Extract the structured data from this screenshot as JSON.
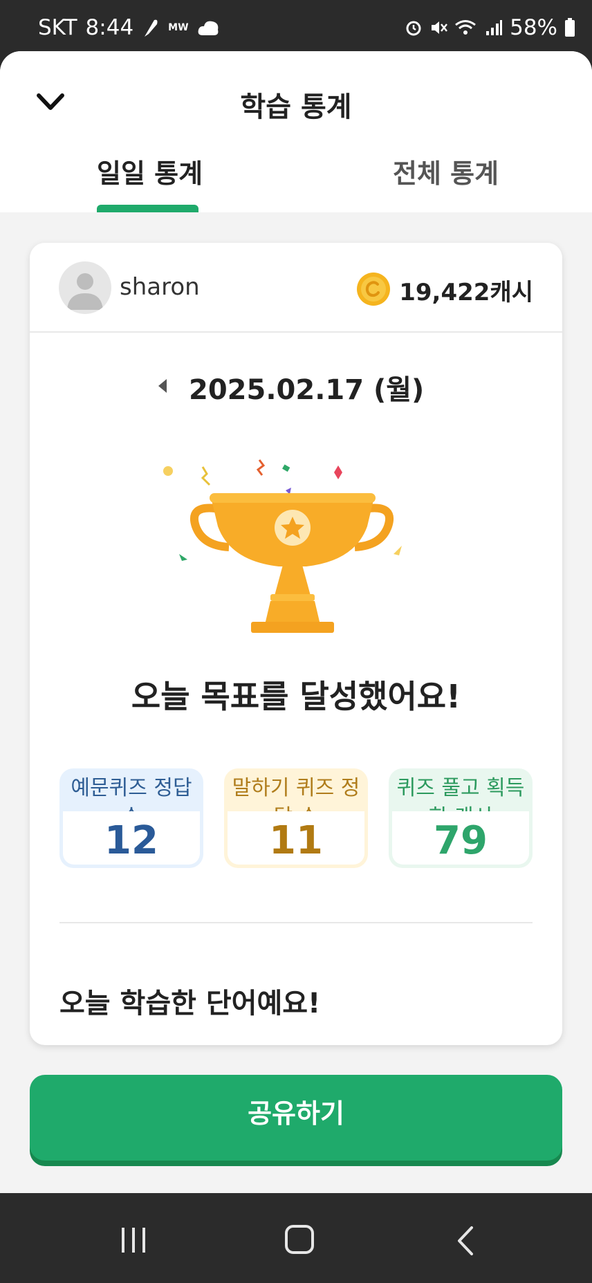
{
  "status_bar": {
    "carrier": "SKT",
    "time": "8:44",
    "left_icons": [
      "quill-icon",
      "mw-icon",
      "cloud-icon"
    ],
    "mw_text": "MW",
    "right_icons": [
      "alarm-icon",
      "mute-icon",
      "wifi-icon",
      "signal-icon",
      "battery-icon"
    ],
    "battery": "58%"
  },
  "header": {
    "title": "학습 통계",
    "back_icon": "chevron-down-icon"
  },
  "tabs": [
    {
      "label": "일일 통계",
      "active": true
    },
    {
      "label": "전체 통계",
      "active": false
    }
  ],
  "profile": {
    "name": "sharon",
    "cash": "19,422캐시"
  },
  "date": {
    "text": "2025.02.17 (월)"
  },
  "goal_message": "오늘 목표를 달성했어요!",
  "stats": [
    {
      "label": "예문퀴즈 정답 수",
      "value": "12"
    },
    {
      "label": "말하기 퀴즈 정답 수",
      "value": "11"
    },
    {
      "label": "퀴즈 풀고 획득한 캐시",
      "value": "79"
    }
  ],
  "words_title": "오늘 학습한 단어예요!",
  "share_button": "공유하기",
  "colors": {
    "accent": "#1faa6b",
    "trophy": "#f6a623",
    "stat_blue": "#2a5a98",
    "stat_yellow": "#b17a12",
    "stat_green": "#2ea56b"
  }
}
